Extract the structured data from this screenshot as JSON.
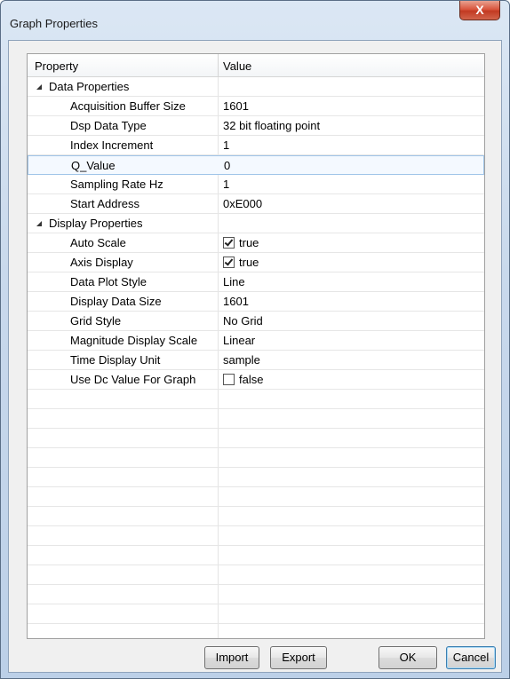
{
  "window": {
    "title": "Graph Properties",
    "close_label": "X"
  },
  "grid": {
    "columns": {
      "property": "Property",
      "value": "Value"
    },
    "categories": [
      {
        "label": "Data Properties",
        "rows": [
          {
            "name": "Acquisition Buffer Size",
            "value": "1601"
          },
          {
            "name": "Dsp Data Type",
            "value": "32 bit floating point"
          },
          {
            "name": "Index Increment",
            "value": "1"
          },
          {
            "name": "Q_Value",
            "value": "0",
            "selected": true
          },
          {
            "name": "Sampling Rate Hz",
            "value": "1"
          },
          {
            "name": "Start Address",
            "value": "0xE000"
          }
        ]
      },
      {
        "label": "Display Properties",
        "rows": [
          {
            "name": "Auto Scale",
            "value": "true",
            "checkbox": true,
            "checked": true
          },
          {
            "name": "Axis Display",
            "value": "true",
            "checkbox": true,
            "checked": true
          },
          {
            "name": "Data Plot Style",
            "value": "Line"
          },
          {
            "name": "Display Data Size",
            "value": "1601"
          },
          {
            "name": "Grid Style",
            "value": "No Grid"
          },
          {
            "name": "Magnitude Display Scale",
            "value": "Linear"
          },
          {
            "name": "Time Display Unit",
            "value": "sample"
          },
          {
            "name": "Use Dc Value For Graph",
            "value": "false",
            "checkbox": true,
            "checked": false
          }
        ]
      }
    ]
  },
  "buttons": {
    "import": "Import",
    "export": "Export",
    "ok": "OK",
    "cancel": "Cancel"
  }
}
